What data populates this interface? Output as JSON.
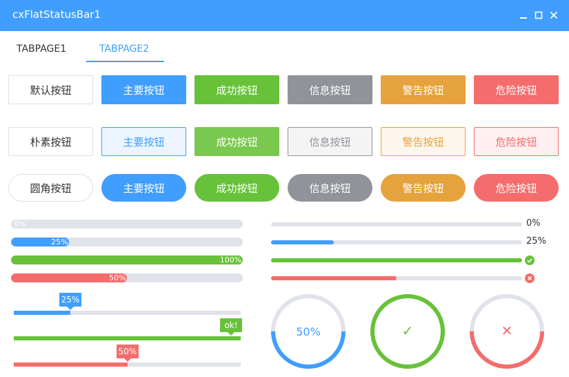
{
  "window": {
    "title": "cxFlatStatusBar1",
    "minimize_icon": "minimize-icon",
    "maximize_icon": "maximize-icon",
    "close_icon": "close-icon"
  },
  "tabs": [
    {
      "label": "TABPAGE1",
      "active": false
    },
    {
      "label": "TABPAGE2",
      "active": true
    }
  ],
  "colors": {
    "primary": "#409eff",
    "success": "#67c23a",
    "info": "#909399",
    "warning": "#e6a23c",
    "danger": "#f56c6c",
    "track": "#e0e3ea"
  },
  "buttons": {
    "default_row": [
      "默认按钮",
      "主要按钮",
      "成功按钮",
      "信息按钮",
      "警告按钮",
      "危险按钮"
    ],
    "plain_row": [
      "朴素按钮",
      "主要按钮",
      "成功按钮",
      "信息按钮",
      "警告按钮",
      "危险按钮"
    ],
    "round_row": [
      "圆角按钮",
      "主要按钮",
      "成功按钮",
      "信息按钮",
      "警告按钮",
      "危险按钮"
    ]
  },
  "progress_inner": [
    {
      "percent": 0,
      "label": "0%",
      "color": "#409eff"
    },
    {
      "percent": 25,
      "label": "25%",
      "color": "#409eff"
    },
    {
      "percent": 100,
      "label": "100%",
      "color": "#67c23a"
    },
    {
      "percent": 50,
      "label": "50%",
      "color": "#f56c6c"
    }
  ],
  "progress_thin": [
    {
      "percent": 0,
      "label": "0%",
      "color": "#409eff",
      "status": "text"
    },
    {
      "percent": 25,
      "label": "25%",
      "color": "#409eff",
      "status": "text"
    },
    {
      "percent": 100,
      "label": "",
      "color": "#67c23a",
      "status": "success-icon"
    },
    {
      "percent": 50,
      "label": "",
      "color": "#f56c6c",
      "status": "error-icon"
    }
  ],
  "progress_tooltip": [
    {
      "percent": 25,
      "label": "25%",
      "color": "#409eff"
    },
    {
      "percent": 100,
      "label": "ok!",
      "color": "#67c23a"
    },
    {
      "percent": 50,
      "label": "50%",
      "color": "#f56c6c"
    }
  ],
  "progress_circle": [
    {
      "percent": 50,
      "label": "50%",
      "color": "#409eff",
      "icon": ""
    },
    {
      "percent": 100,
      "label": "✓",
      "color": "#67c23a",
      "icon": "check-icon"
    },
    {
      "percent": 50,
      "label": "✕",
      "color": "#f56c6c",
      "icon": "close-icon"
    }
  ]
}
